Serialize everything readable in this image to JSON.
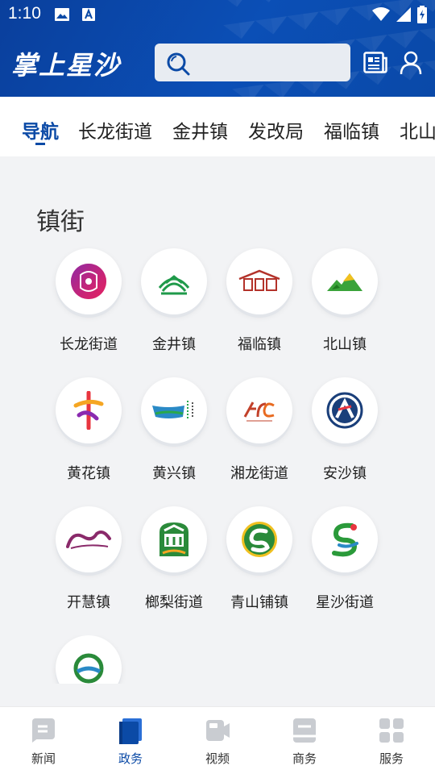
{
  "status": {
    "time": "1:10"
  },
  "header": {
    "logo_text": "掌上星沙",
    "search_placeholder": ""
  },
  "tabs": [
    {
      "label": "导航",
      "active": true
    },
    {
      "label": "长龙街道"
    },
    {
      "label": "金井镇"
    },
    {
      "label": "发改局"
    },
    {
      "label": "福临镇"
    },
    {
      "label": "北山"
    }
  ],
  "section": {
    "title": "镇街"
  },
  "towns": [
    {
      "label": "长龙街道",
      "icon": "changlong-emblem-icon",
      "color": "#e0246b"
    },
    {
      "label": "金井镇",
      "icon": "jinjing-emblem-icon",
      "color": "#1f9a4a"
    },
    {
      "label": "福临镇",
      "icon": "fulin-emblem-icon",
      "color": "#b3322a"
    },
    {
      "label": "北山镇",
      "icon": "beishan-emblem-icon",
      "color": "#2f9a2f"
    },
    {
      "label": "黄花镇",
      "icon": "huanghua-emblem-icon",
      "color": "#e03a4c"
    },
    {
      "label": "黄兴镇",
      "icon": "huangxing-emblem-icon",
      "color": "#1f7fb6"
    },
    {
      "label": "湘龙街道",
      "icon": "xianglong-emblem-icon",
      "color": "#c2412a"
    },
    {
      "label": "安沙镇",
      "icon": "ansha-emblem-icon",
      "color": "#1a3f7a"
    },
    {
      "label": "开慧镇",
      "icon": "kaihui-emblem-icon",
      "color": "#8a2a6a"
    },
    {
      "label": "榔梨街道",
      "icon": "langli-emblem-icon",
      "color": "#2a8a3a"
    },
    {
      "label": "青山铺镇",
      "icon": "qingshanpu-emblem-icon",
      "color": "#2a8a3a"
    },
    {
      "label": "星沙街道",
      "icon": "xingsha-emblem-icon",
      "color": "#2a9a3a"
    },
    {
      "label": "",
      "icon": "partial-emblem-icon",
      "color": "#1f8a6a"
    }
  ],
  "bottom_nav": [
    {
      "label": "新闻",
      "icon": "news-tab-icon",
      "active": false
    },
    {
      "label": "政务",
      "icon": "government-tab-icon",
      "active": true
    },
    {
      "label": "视频",
      "icon": "video-tab-icon",
      "active": false
    },
    {
      "label": "商务",
      "icon": "business-tab-icon",
      "active": false
    },
    {
      "label": "服务",
      "icon": "services-tab-icon",
      "active": false
    }
  ],
  "colors": {
    "brand_blue": "#0b4aa6",
    "inactive_icon": "#c9ccd1"
  }
}
